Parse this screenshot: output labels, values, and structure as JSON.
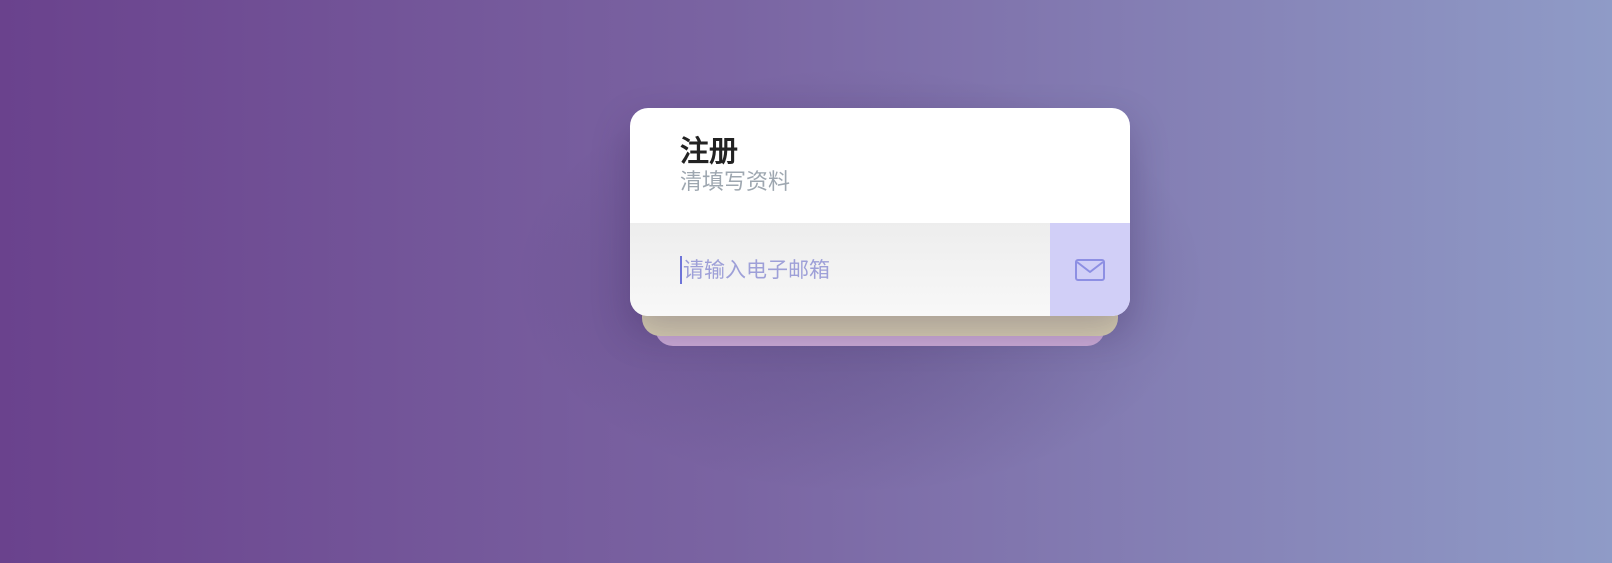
{
  "registration": {
    "title": "注册",
    "subtitle": "清填写资料",
    "email_placeholder": "请输入电子邮箱",
    "email_value": "",
    "submit_icon": "envelope-icon"
  },
  "colors": {
    "background_start": "#6a428d",
    "background_end": "#8f9bc7",
    "card": "#ffffff",
    "input_background": "#f2f2f2",
    "button_background": "#d1cff7",
    "accent": "#6e74d8",
    "layer_middle": "#d8d0b1",
    "layer_back": "#c9a9d4"
  }
}
